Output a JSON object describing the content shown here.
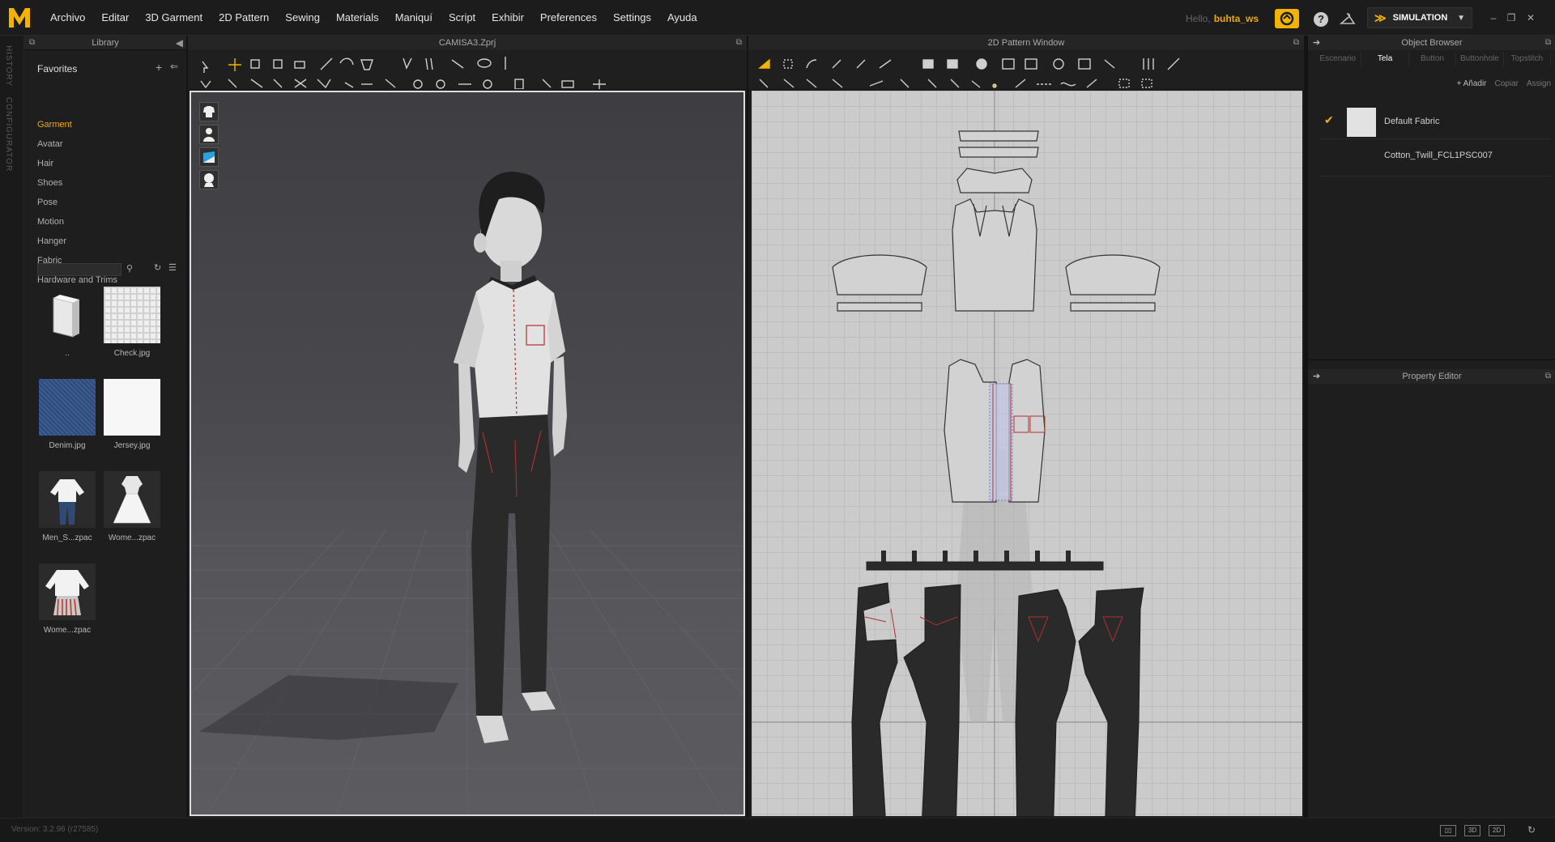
{
  "app": {
    "logo_letter": "M",
    "accent": "#f2b400",
    "menu": [
      "Archivo",
      "Editar",
      "3D Garment",
      "2D Pattern",
      "Sewing",
      "Materials",
      "Maniquí",
      "Script",
      "Exhibir",
      "Preferences",
      "Settings",
      "Ayuda"
    ],
    "hello_prefix": "Hello,",
    "username": "buhta_ws",
    "mode_label": "SIMULATION",
    "icons": {
      "cloud": "cloud-icon",
      "help": "help-icon",
      "hanger": "hanger-icon"
    }
  },
  "side_tabs": [
    "HISTORY",
    "CONFIGURATOR"
  ],
  "library": {
    "title": "Library",
    "favorites": "Favorites",
    "items": [
      "Garment",
      "Avatar",
      "Hair",
      "Shoes",
      "Pose",
      "Motion",
      "Hanger",
      "Fabric",
      "Hardware and Trims"
    ],
    "active_item": "Garment",
    "search_placeholder": "",
    "thumbnails": [
      {
        "label": "..",
        "kind": "folder"
      },
      {
        "label": "Check.jpg",
        "kind": "check"
      },
      {
        "label": "Denim.jpg",
        "kind": "denim"
      },
      {
        "label": "Jersey.jpg",
        "kind": "jersey"
      },
      {
        "label": "Men_S...zpac",
        "kind": "men"
      },
      {
        "label": "Wome...zpac",
        "kind": "women1"
      },
      {
        "label": "Wome...zpac",
        "kind": "women2"
      }
    ]
  },
  "viewport3d": {
    "title": "CAMISA3.Zprj"
  },
  "pattern_window": {
    "title": "2D Pattern Window"
  },
  "object_browser": {
    "title": "Object Browser",
    "tabs": [
      "Escenario",
      "Tela",
      "Button",
      "Buttonhole",
      "Topstitch"
    ],
    "active_tab": "Tela",
    "actions": [
      "+ Añadir",
      "Copiar",
      "Assign"
    ],
    "fabrics": [
      {
        "name": "Default Fabric",
        "selected": true
      },
      {
        "name": "Cotton_Twill_FCL1PSC007",
        "selected": false
      }
    ]
  },
  "property_editor": {
    "title": "Property Editor"
  },
  "status": {
    "version": "Version: 3.2.96    (r27585)",
    "view_buttons": [
      "layout-icon",
      "3D",
      "2D",
      "refresh-icon"
    ]
  }
}
